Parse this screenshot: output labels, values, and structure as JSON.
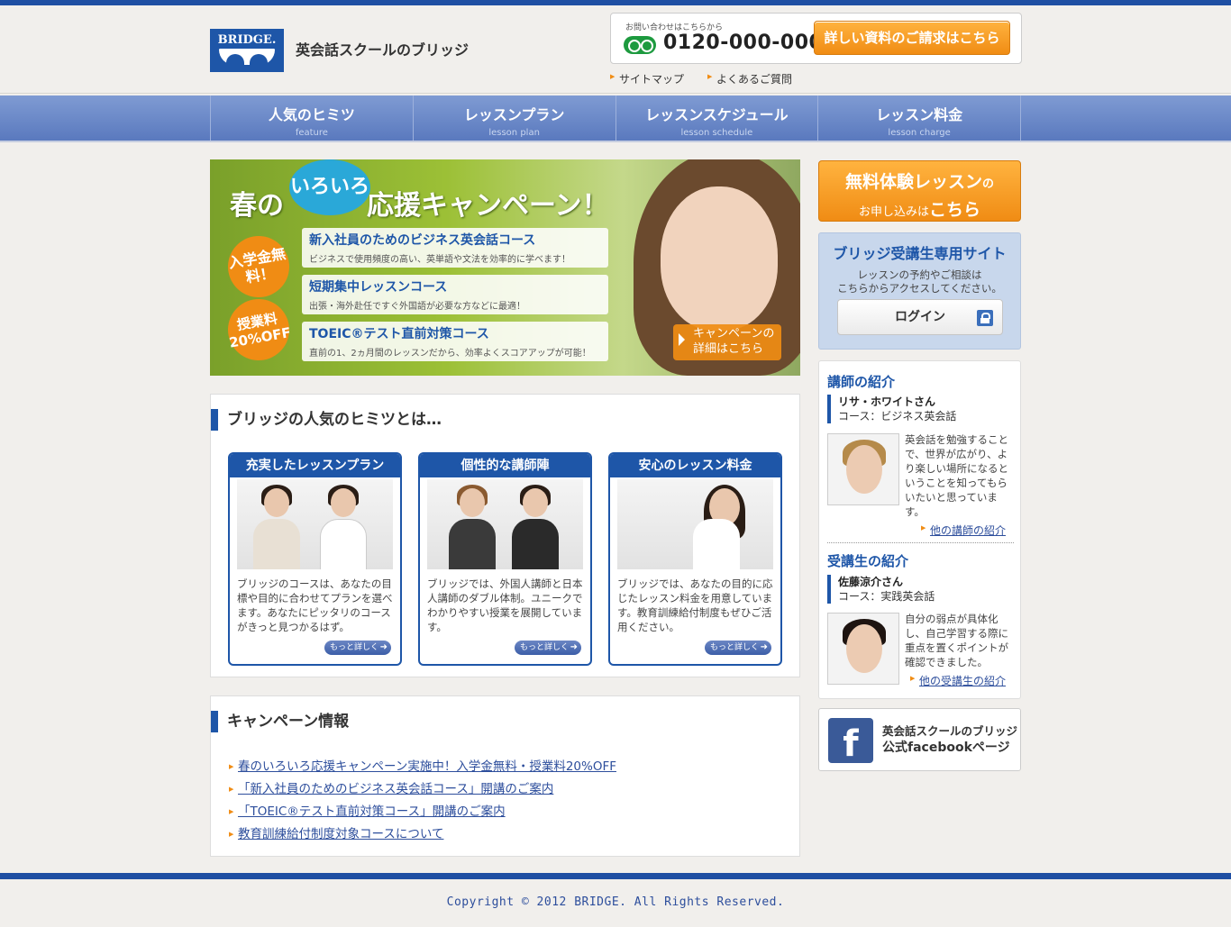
{
  "header": {
    "logo_text": "BRIDGE.",
    "site_name": "英会話スクールのブリッジ",
    "contact_label": "お問い合わせはこちらから",
    "phone": "0120-000-000",
    "request_button": "詳しい資料のご請求はこちら",
    "sublinks": [
      "サイトマップ",
      "よくあるご質問"
    ]
  },
  "nav": [
    {
      "jp": "人気のヒミツ",
      "en": "feature"
    },
    {
      "jp": "レッスンプラン",
      "en": "lesson plan"
    },
    {
      "jp": "レッスンスケジュール",
      "en": "lesson schedule"
    },
    {
      "jp": "レッスン料金",
      "en": "lesson charge"
    }
  ],
  "hero": {
    "title_pre": "春の",
    "bubble": "いろいろ",
    "title_post": "応援キャンペーン！",
    "badge1": "入学金無料！",
    "badge2": "授業料20%OFF",
    "courses": [
      {
        "title": "新入社員のためのビジネス英会話コース",
        "desc": "ビジネスで使用頻度の高い、英単語や文法を効率的に学べます！"
      },
      {
        "title": "短期集中レッスンコース",
        "desc": "出張・海外赴任ですぐ外国語が必要な方などに最適！"
      },
      {
        "title": "TOEIC®テスト直前対策コース",
        "desc": "直前の1、2ヵ月間のレッスンだから、効率よくスコアアップが可能！"
      }
    ],
    "detail_button": "キャンペーンの詳細はこちら"
  },
  "features": {
    "title": "ブリッジの人気のヒミツとは…",
    "more_label": "もっと詳しく",
    "items": [
      {
        "title": "充実したレッスンプラン",
        "text": "ブリッジのコースは、あなたの目標や目的に合わせてプランを選べます。あなたにピッタリのコースがきっと見つかるはず。"
      },
      {
        "title": "個性的な講師陣",
        "text": "ブリッジでは、外国人講師と日本人講師のダブル体制。ユニークでわかりやすい授業を展開しています。"
      },
      {
        "title": "安心のレッスン料金",
        "text": "ブリッジでは、あなたの目的に応じたレッスン料金を用意しています。教育訓練給付制度もぜひご活用ください。"
      }
    ]
  },
  "campaign": {
    "title": "キャンペーン情報",
    "items": [
      "春のいろいろ応援キャンペーン実施中！入学金無料・授業料20%OFF",
      "「新入社員のためのビジネス英会話コース」開講のご案内",
      "「TOEIC®テスト直前対策コース」開講のご案内",
      "教育訓練給付制度対象コースについて"
    ]
  },
  "sidebar": {
    "trial_line1": "無料体験レッスン",
    "trial_no": "の",
    "trial_line2": "お申し込みは",
    "trial_kochira": "こちら",
    "member_title": "ブリッジ受講生専用サイト",
    "member_desc1": "レッスンの予約やご相談は",
    "member_desc2": "こちらからアクセスしてください。",
    "login": "ログイン",
    "teacher_title": "講師の紹介",
    "teacher_name": "リサ・ホワイトさん",
    "teacher_course": "コース：ビジネス英会話",
    "teacher_text": "英会話を勉強することで、世界が広がり、より楽しい場所になるということを知ってもらいたいと思っています。",
    "teacher_link": "他の講師の紹介",
    "student_title": "受講生の紹介",
    "student_name": "佐藤涼介さん",
    "student_course": "コース：実践英会話",
    "student_text": "自分の弱点が具体化し、自己学習する際に重点を置くポイントが確認できました。",
    "student_link": "他の受講生の紹介",
    "fb_line1": "英会話スクールのブリッジ",
    "fb_line2": "公式facebookページ"
  },
  "footer": {
    "copyright": "Copyright © 2012 BRIDGE. All Rights Reserved."
  }
}
